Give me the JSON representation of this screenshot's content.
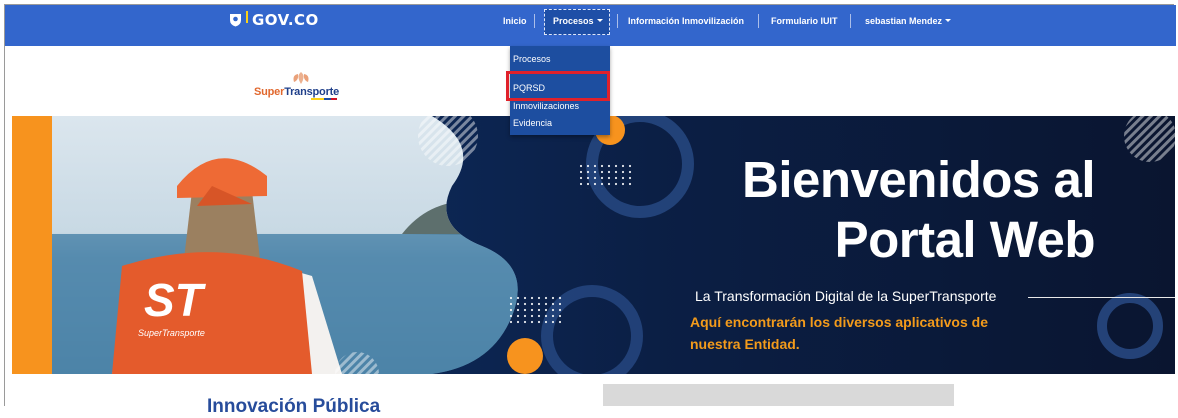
{
  "header": {
    "brand": "GOV.CO",
    "nav": [
      {
        "label": "Inicio",
        "active": false
      },
      {
        "label": "Procesos",
        "active": true,
        "dropdown": true
      },
      {
        "label": "Información Inmovilización",
        "active": false
      },
      {
        "label": "Formulario IUIT",
        "active": false
      },
      {
        "label": "sebastian Mendez",
        "active": false,
        "dropdown": true
      }
    ]
  },
  "dropdown": {
    "items": [
      "Procesos",
      "PQRSD",
      "Inmovilizaciones",
      "Evidencia"
    ],
    "highlighted": "PQRSD"
  },
  "logo": {
    "text_a": "Super",
    "text_b": "Transporte"
  },
  "banner": {
    "title_line1": "Bienvenidos al",
    "title_line2": "Portal Web",
    "subtitle": "La Transformación Digital de la SuperTransporte",
    "tagline_line1": "Aquí encontrarán los diversos aplicativos de",
    "tagline_line2": "nuestra Entidad.",
    "vest_logo": "ST",
    "vest_text": "SuperTransporte"
  },
  "section": {
    "title": "Innovación Pública"
  },
  "colors": {
    "nav_bg": "#3366cc",
    "dropdown_bg": "#1d4ea0",
    "highlight": "#e0212a",
    "banner_dark": "#0b1a38",
    "orange": "#f39b1b"
  }
}
